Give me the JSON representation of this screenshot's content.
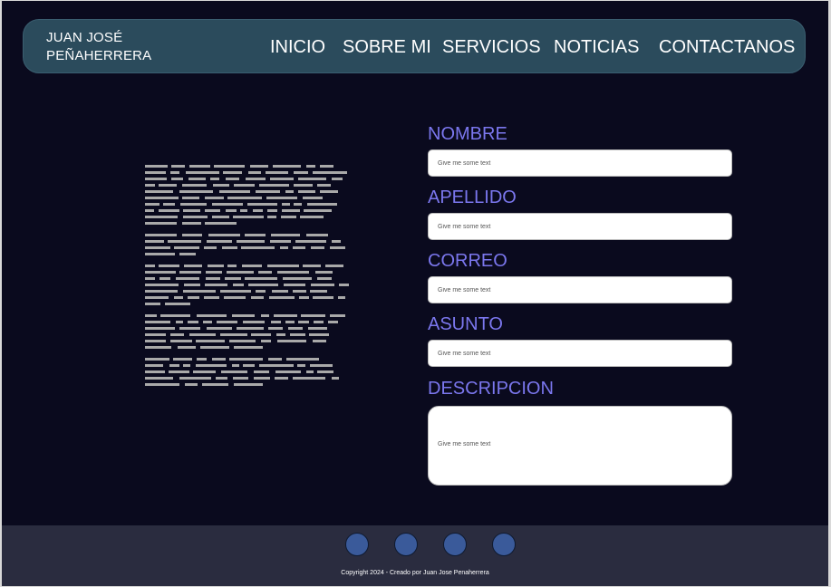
{
  "header": {
    "brand_line1": "JUAN JOSÉ",
    "brand_line2": "PEÑAHERRERA",
    "nav": [
      {
        "label": "INICIO"
      },
      {
        "label": "SOBRE MI"
      },
      {
        "label": "SERVICIOS"
      },
      {
        "label": "NOTICIAS"
      },
      {
        "label": "CONTACTANOS"
      }
    ]
  },
  "form": {
    "fields": [
      {
        "label": "NOMBRE",
        "placeholder": "Give me some text"
      },
      {
        "label": "APELLIDO",
        "placeholder": "Give me some text"
      },
      {
        "label": "CORREO",
        "placeholder": "Give me some text"
      },
      {
        "label": "ASUNTO",
        "placeholder": "Give me some text"
      },
      {
        "label": "DESCRIPCION",
        "placeholder": "Give me some text"
      }
    ]
  },
  "footer": {
    "social_icons": [
      "social-icon-1",
      "social-icon-2",
      "social-icon-3",
      "social-icon-4"
    ],
    "copyright": "Copyright 2024  - Creado por Juan Jose Penaherrera"
  },
  "colors": {
    "background": "#0a0a1e",
    "header": "#2b4b5c",
    "label": "#7b77ee",
    "footer": "#2a2c3f",
    "social": "#3a5a9a"
  }
}
